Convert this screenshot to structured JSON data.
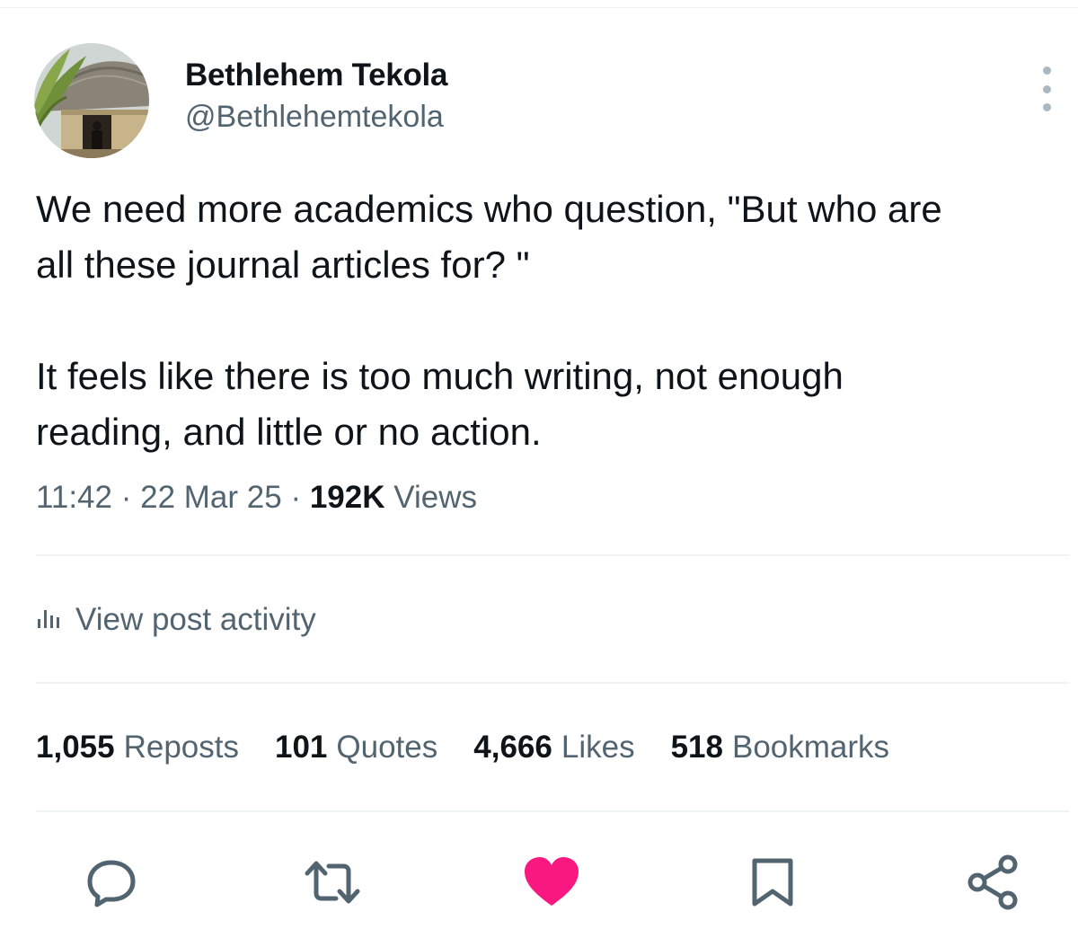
{
  "author": {
    "name": "Bethlehem Tekola",
    "handle": "@Bethlehemtekola"
  },
  "post": {
    "paragraphs": [
      [
        "We need more academics who question, \"But who are",
        "all these journal articles for? \""
      ],
      [
        "It feels like there is too much writing, not enough",
        "reading, and little or no action."
      ]
    ],
    "time": "11:42",
    "date": "22 Mar 25",
    "separator": "·",
    "views_count": "192K",
    "views_label": "Views"
  },
  "activity": {
    "label": "View post activity"
  },
  "stats": {
    "reposts": {
      "count": "1,055",
      "label": "Reposts"
    },
    "quotes": {
      "count": "101",
      "label": "Quotes"
    },
    "likes": {
      "count": "4,666",
      "label": "Likes"
    },
    "bookmarks": {
      "count": "518",
      "label": "Bookmarks"
    }
  },
  "actions": {
    "icons": [
      "reply-icon",
      "repost-icon",
      "like-icon",
      "bookmark-icon",
      "share-icon"
    ],
    "like_active": true,
    "like_color": "#f91880",
    "icon_color": "#536471"
  },
  "colors": {
    "text": "#0f1419",
    "secondary": "#536471",
    "divider": "#eff3f4"
  }
}
